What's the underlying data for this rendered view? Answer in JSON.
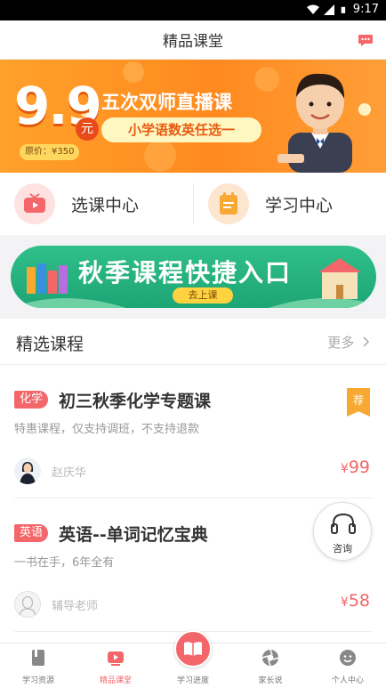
{
  "statusbar": {
    "time": "9:17"
  },
  "header": {
    "title": "精品课堂"
  },
  "banner": {
    "price": "9.9",
    "yuan": "元",
    "headline": "五次双师直播课",
    "subline": "小学语数英任选一",
    "original_price": "原价：¥350"
  },
  "quick": {
    "left_label": "选课中心",
    "right_label": "学习中心"
  },
  "autumn": {
    "title": "秋季课程快捷入口",
    "go": "去上课"
  },
  "section": {
    "title": "精选课程",
    "more": "更多"
  },
  "courses": [
    {
      "tag": "化学",
      "title": "初三秋季化学专题课",
      "desc": "特惠课程，仅支持调班，不支持退款",
      "teacher": "赵庆华",
      "currency": "¥",
      "price": "99",
      "badge": "荐"
    },
    {
      "tag": "英语",
      "title": "英语--单词记忆宝典",
      "desc": "一书在手，6年全有",
      "teacher": "辅导老师",
      "currency": "¥",
      "price": "58"
    }
  ],
  "consult": {
    "label": "咨询"
  },
  "tabbar": {
    "items": [
      {
        "label": "学习资源",
        "icon": "book-icon"
      },
      {
        "label": "精品课堂",
        "icon": "video-icon"
      },
      {
        "label": "学习进度",
        "icon": "open-book-icon"
      },
      {
        "label": "家长说",
        "icon": "aperture-icon"
      },
      {
        "label": "个人中心",
        "icon": "user-icon"
      }
    ]
  },
  "colors": {
    "accent": "#f3676b",
    "banner": "#ff8a1f",
    "autumn": "#1ea575"
  }
}
